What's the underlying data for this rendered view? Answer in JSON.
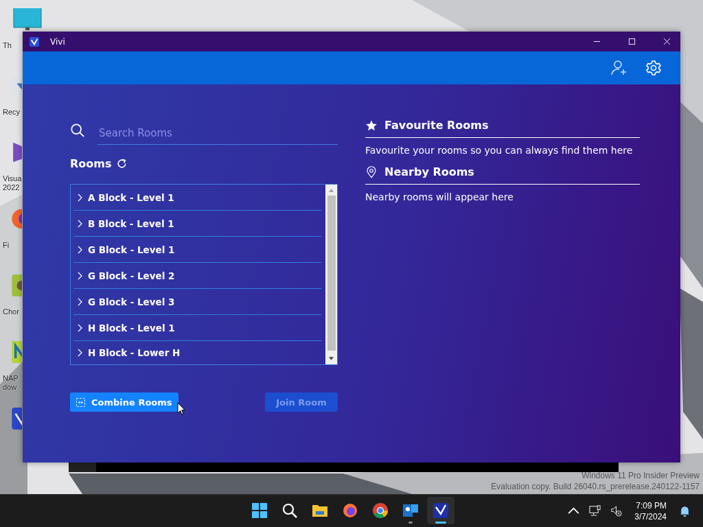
{
  "desktop": {
    "icons": [
      {
        "kind": "monitor",
        "lines": [
          "Th"
        ]
      },
      {
        "kind": "recycle",
        "lines": [
          "Recy"
        ]
      },
      {
        "kind": "studio",
        "lines": [
          "Visua",
          "2022"
        ]
      },
      {
        "kind": "firefox",
        "lines": [
          "Fi"
        ]
      },
      {
        "kind": "game",
        "lines": [
          "Chor"
        ]
      },
      {
        "kind": "nap",
        "lines": [
          "NAP",
          "dow"
        ]
      },
      {
        "kind": "vivi"
      }
    ],
    "watermark": [
      "Windows 11 Pro Insider Preview",
      "Evaluation copy. Build 26040.rs_prerelease.240122-1157"
    ]
  },
  "window": {
    "title": "Vivi"
  },
  "search": {
    "placeholder": "Search Rooms"
  },
  "rooms": {
    "heading": "Rooms",
    "items": [
      {
        "label": "A Block - Level 1",
        "expanded": false
      },
      {
        "label": "B Block - Level 1",
        "expanded": false
      },
      {
        "label": "G Block - Level 1",
        "expanded": false
      },
      {
        "label": "G Block - Level 2",
        "expanded": false
      },
      {
        "label": "G Block - Level 3",
        "expanded": false
      },
      {
        "label": "H Block - Level 1",
        "expanded": false
      },
      {
        "label": "H Block - Lower H",
        "expanded": false
      }
    ]
  },
  "buttons": [
    {
      "kind": "combine",
      "label": "Combine Rooms",
      "disabled": false
    },
    {
      "kind": "join",
      "label": "Join Room",
      "disabled": true
    }
  ],
  "favourites": {
    "title": "Favourite Rooms",
    "text": "Favourite your rooms so you can always find them here"
  },
  "nearby": {
    "title": "Nearby Rooms",
    "text": "Nearby rooms will appear here"
  },
  "taskbar": {
    "apps": [
      {
        "kind": "start",
        "running": false,
        "selected": false
      },
      {
        "kind": "search",
        "running": false,
        "selected": false
      },
      {
        "kind": "files",
        "running": false,
        "selected": false
      },
      {
        "kind": "firefox",
        "running": false,
        "selected": false
      },
      {
        "kind": "chrome",
        "running": false,
        "selected": false
      },
      {
        "kind": "teams",
        "running": true,
        "selected": false
      },
      {
        "kind": "vivi",
        "running": true,
        "selected": true
      }
    ],
    "time": "7:09 PM",
    "date": "3/7/2024"
  }
}
